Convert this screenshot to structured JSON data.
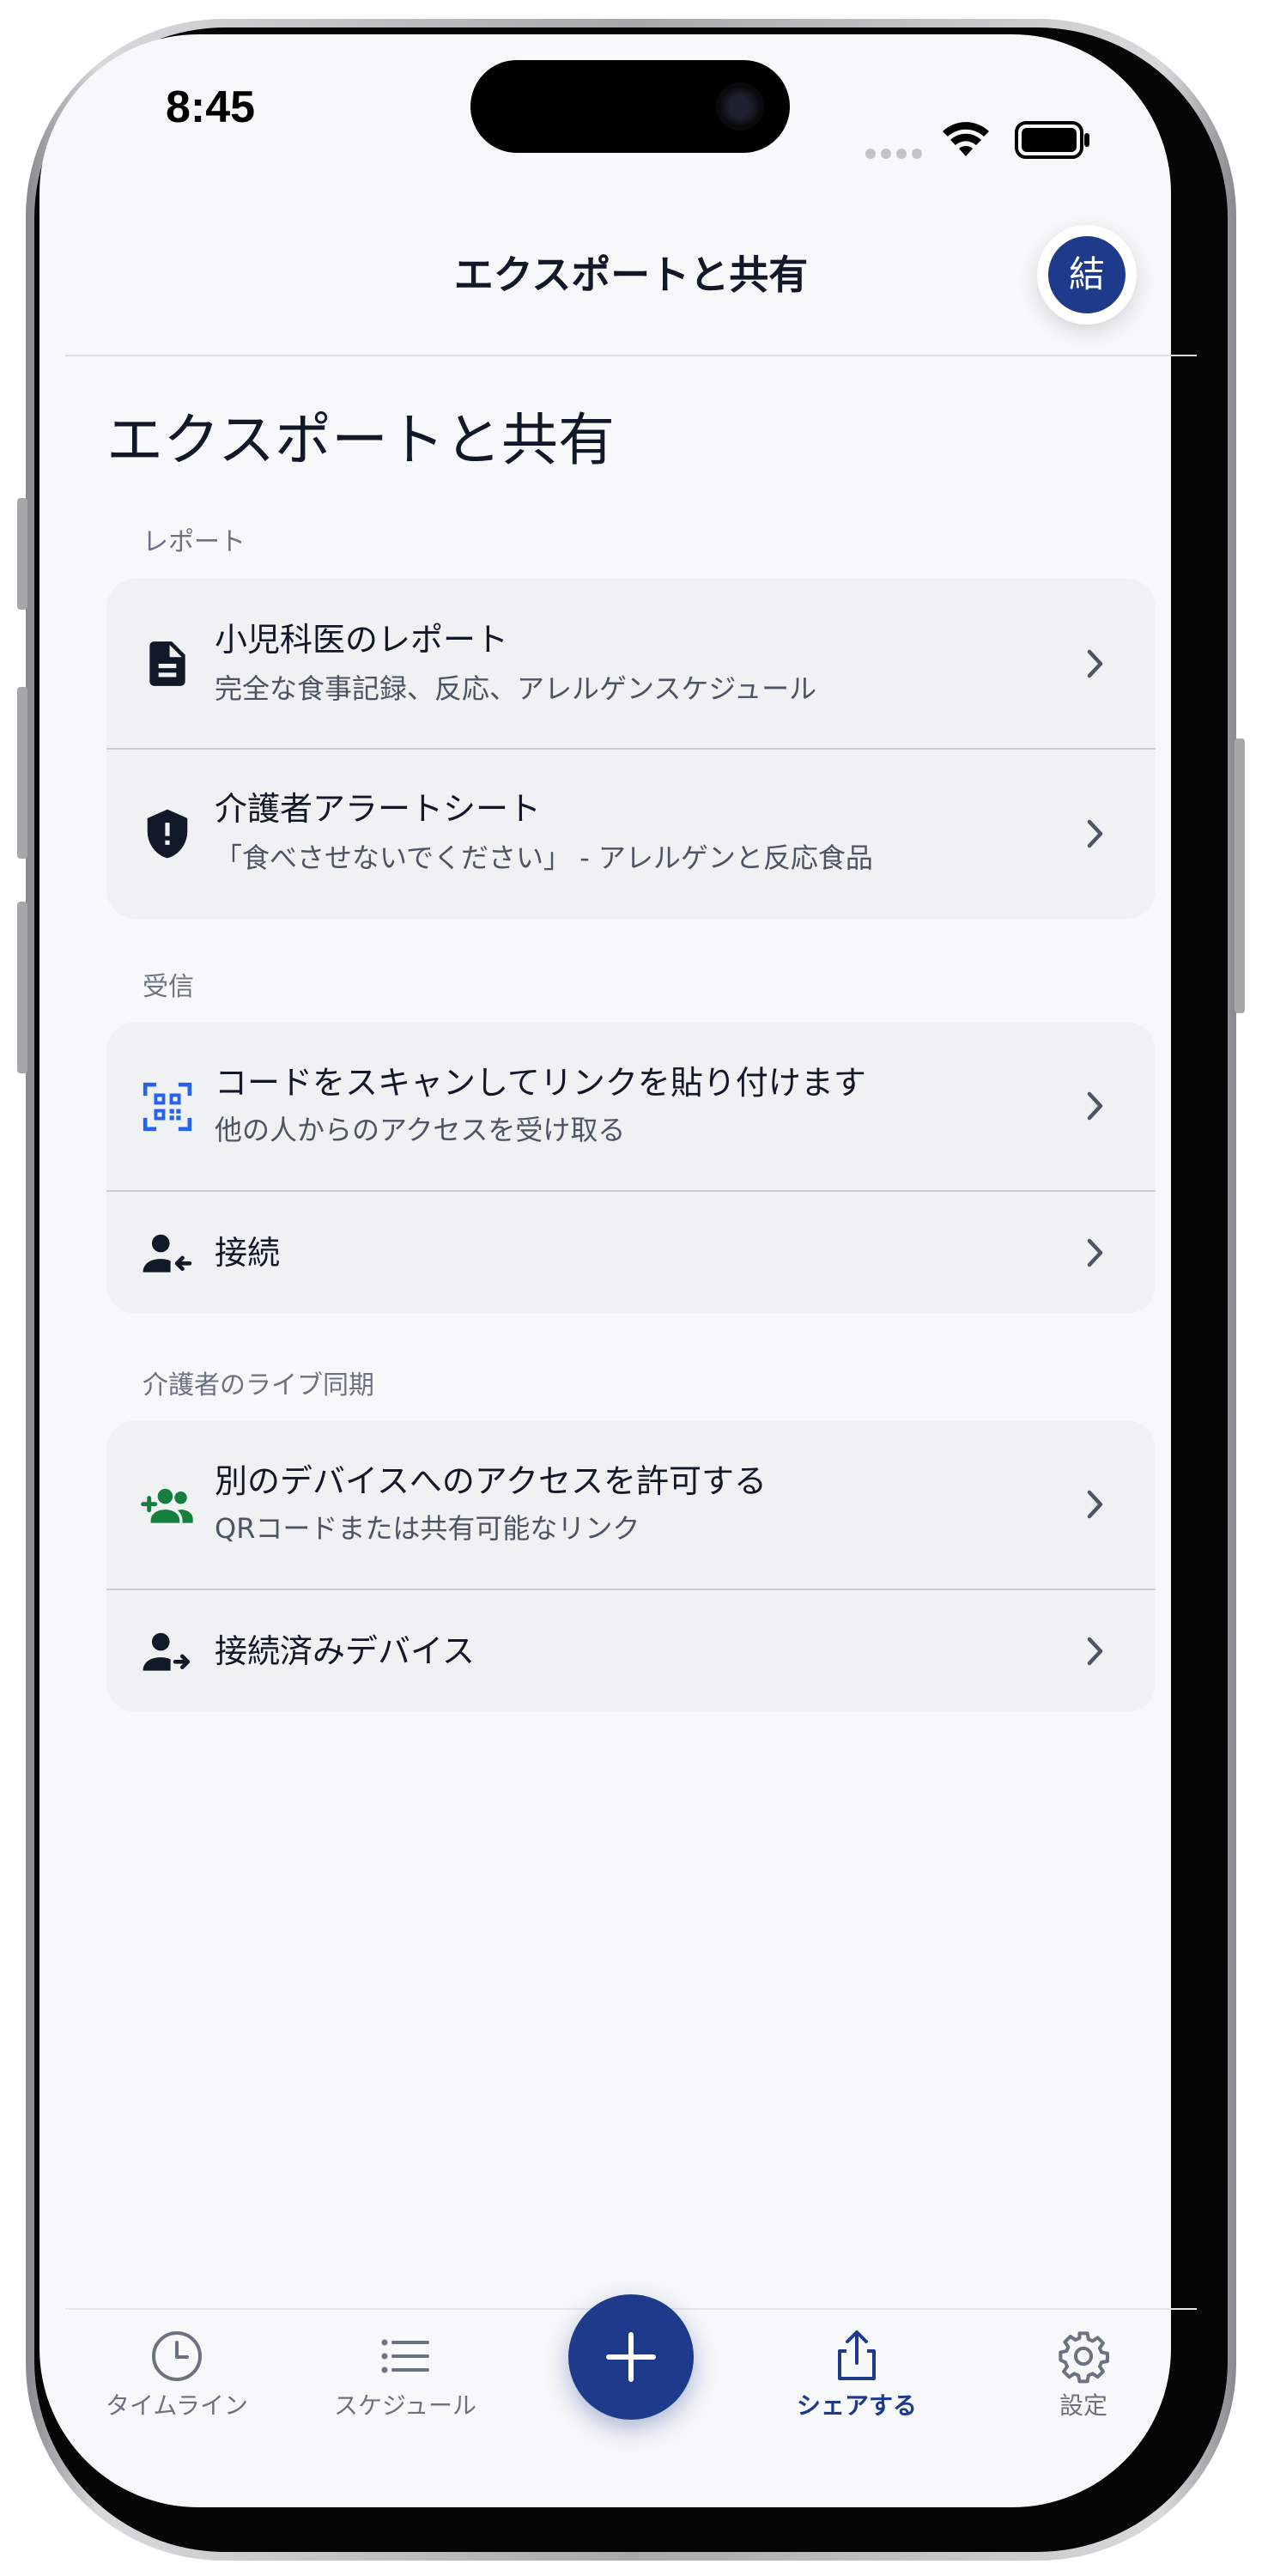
{
  "status_bar": {
    "time": "8:45"
  },
  "header": {
    "title": "エクスポートと共有",
    "avatar_initial": "結"
  },
  "page_title": "エクスポートと共有",
  "sections": [
    {
      "label": "レポート",
      "items": [
        {
          "title": "小児科医のレポート",
          "subtitle": "完全な食事記録、反応、アレルゲンスケジュール",
          "icon": "document-icon"
        },
        {
          "title": "介護者アラートシート",
          "subtitle": "「食べさせないでください」 - アレルゲンと反応食品",
          "icon": "shield-alert-icon"
        }
      ]
    },
    {
      "label": "受信",
      "items": [
        {
          "title": "コードをスキャンしてリンクを貼り付けます",
          "subtitle": "他の人からのアクセスを受け取る",
          "icon": "qr-code-icon"
        },
        {
          "title": "接続",
          "icon": "person-incoming-icon"
        }
      ]
    },
    {
      "label": "介護者のライブ同期",
      "items": [
        {
          "title": "別のデバイスへのアクセスを許可する",
          "subtitle": "QRコードまたは共有可能なリンク",
          "icon": "group-add-icon"
        },
        {
          "title": "接続済みデバイス",
          "icon": "person-outgoing-icon"
        }
      ]
    }
  ],
  "tabbar": {
    "tabs": [
      {
        "label": "タイムライン",
        "icon": "clock-icon"
      },
      {
        "label": "スケジュール",
        "icon": "list-icon"
      },
      {
        "label": "シェアする",
        "icon": "share-icon",
        "active": true
      },
      {
        "label": "設定",
        "icon": "gear-icon"
      }
    ],
    "fab_icon": "plus-icon"
  },
  "colors": {
    "accent": "#1e3a8a",
    "qr_icon": "#2563eb",
    "group_icon": "#15803d",
    "background": "#f7f8fa",
    "card": "#f0f1f3"
  }
}
